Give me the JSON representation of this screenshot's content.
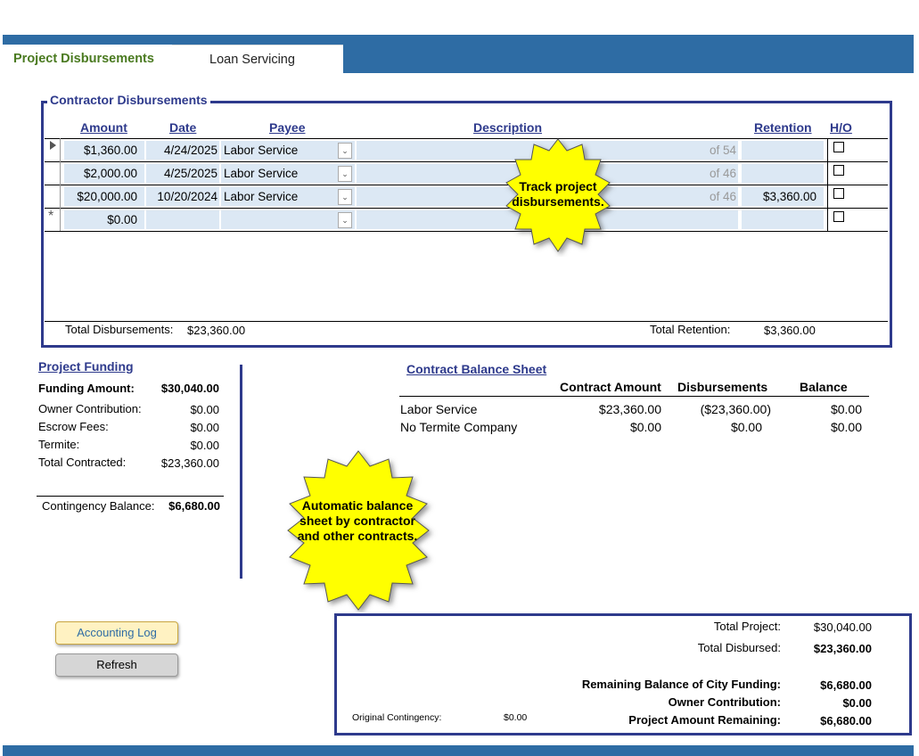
{
  "tabs": [
    {
      "label": "Project Disbursements"
    },
    {
      "label": "Loan Servicing"
    }
  ],
  "disbursements": {
    "legend": "Contractor Disbursements",
    "headers": {
      "amount": "Amount",
      "date": "Date",
      "payee": "Payee",
      "description": "Description",
      "retention": "Retention",
      "ho": "H/O"
    },
    "rows": [
      {
        "amount": "$1,360.00",
        "date": "4/24/2025",
        "payee": "Labor Service",
        "of": "of 54",
        "retention": ""
      },
      {
        "amount": "$2,000.00",
        "date": "4/25/2025",
        "payee": "Labor Service",
        "of": "of 46",
        "retention": ""
      },
      {
        "amount": "$20,000.00",
        "date": "10/20/2024",
        "payee": "Labor Service",
        "of": "of 46",
        "retention": "$3,360.00"
      }
    ],
    "new_row": {
      "marker": "*",
      "amount": "$0.00"
    },
    "total_disbursements_label": "Total Disbursements:",
    "total_disbursements": "$23,360.00",
    "total_retention_label": "Total Retention:",
    "total_retention": "$3,360.00",
    "callout": "Track project disbursements."
  },
  "funding": {
    "title": "Project Funding",
    "rows": [
      {
        "label": "Funding Amount:",
        "value": "$30,040.00"
      },
      {
        "label": "Owner Contribution:",
        "value": "$0.00"
      },
      {
        "label": "Escrow Fees:",
        "value": "$0.00"
      },
      {
        "label": "Termite:",
        "value": "$0.00"
      },
      {
        "label": "Total Contracted:",
        "value": "$23,360.00"
      }
    ],
    "contingency_label": "Contingency Balance:",
    "contingency_value": "$6,680.00"
  },
  "balance_sheet": {
    "title": "Contract Balance Sheet",
    "headers": {
      "contract_amount": "Contract Amount",
      "disbursements": "Disbursements",
      "balance": "Balance"
    },
    "rows": [
      {
        "name": "Labor Service",
        "contract": "$23,360.00",
        "disbursed": "($23,360.00)",
        "balance": "$0.00"
      },
      {
        "name": "No Termite Company",
        "contract": "$0.00",
        "disbursed": "$0.00",
        "balance": "$0.00"
      }
    ],
    "callout": "Automatic balance sheet by contractor and other contracts."
  },
  "buttons": {
    "accounting_log": "Accounting Log",
    "refresh": "Refresh"
  },
  "summary": {
    "total_project_label": "Total Project:",
    "total_project": "$30,040.00",
    "total_disbursed_label": "Total Disbursed:",
    "total_disbursed": "$23,360.00",
    "remaining_city_label": "Remaining Balance of City Funding:",
    "remaining_city": "$6,680.00",
    "owner_contribution_label": "Owner Contribution:",
    "owner_contribution": "$0.00",
    "project_remaining_label": "Project Amount Remaining:",
    "project_remaining": "$6,680.00",
    "original_contingency_label": "Original Contingency:",
    "original_contingency": "$0.00"
  },
  "colors": {
    "accent_blue": "#2e6ca4",
    "navy": "#2e3a8c",
    "green_tab": "#4a7a20",
    "callout_yellow": "#ffff00"
  }
}
